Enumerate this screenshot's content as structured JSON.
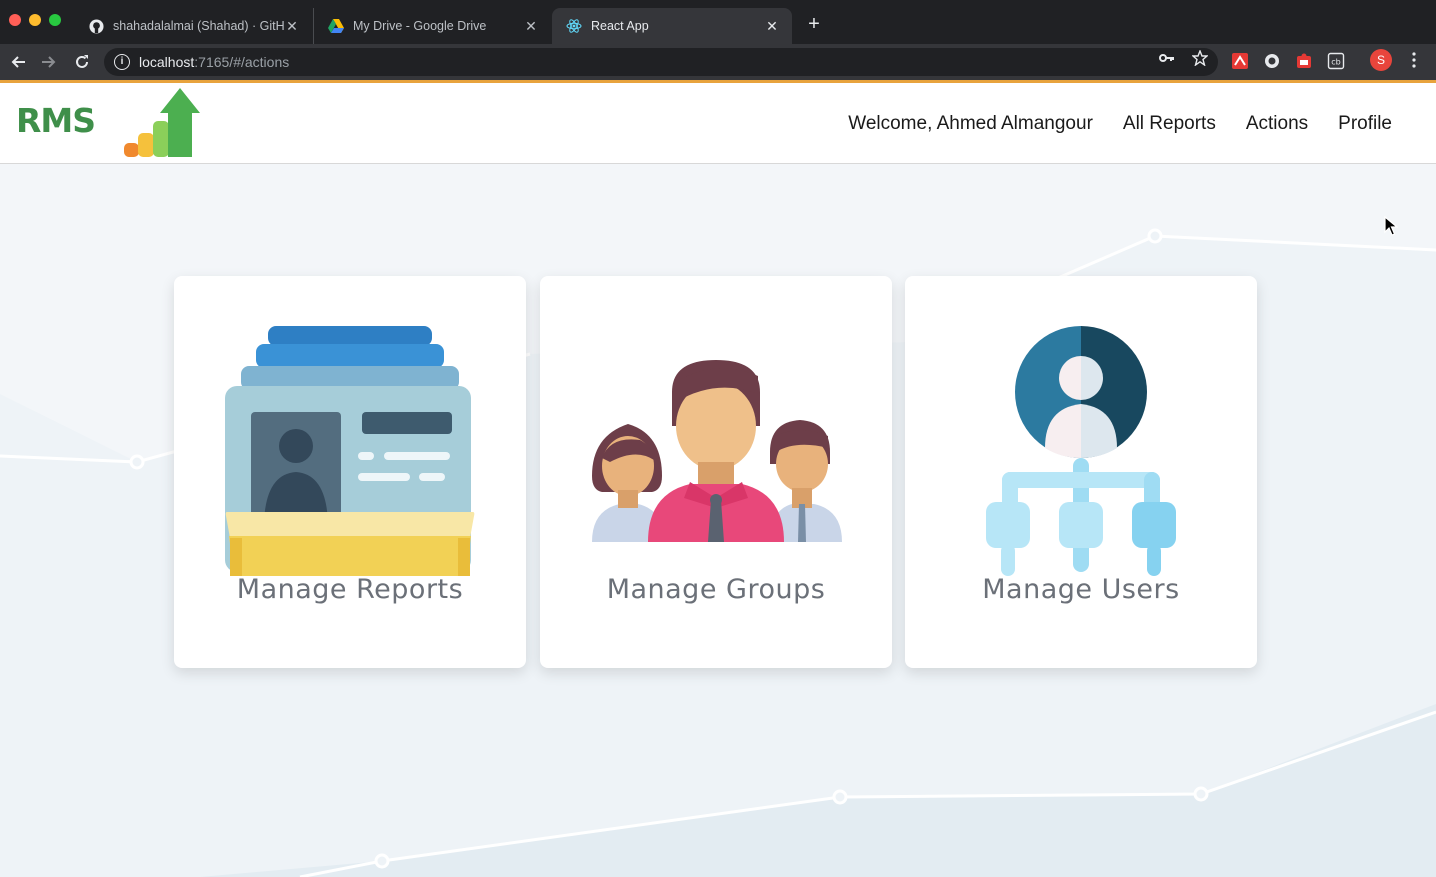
{
  "browser": {
    "tabs": [
      {
        "title": "shahadalalmai (Shahad) · GitHub",
        "icon": "github-icon",
        "active": false
      },
      {
        "title": "My Drive - Google Drive",
        "icon": "google-drive-icon",
        "active": false
      },
      {
        "title": "React App",
        "icon": "react-icon",
        "active": true
      }
    ],
    "address": {
      "host": "localhost",
      "path": ":7165/#/actions"
    },
    "profile_initial": "S"
  },
  "header": {
    "logo_text": "RMS",
    "welcome": "Welcome, Ahmed Almangour",
    "nav": [
      "All Reports",
      "Actions",
      "Profile"
    ]
  },
  "cards": [
    {
      "label": "Manage Reports",
      "icon": "reports-folder-icon"
    },
    {
      "label": "Manage Groups",
      "icon": "group-people-icon"
    },
    {
      "label": "Manage Users",
      "icon": "user-hierarchy-icon"
    }
  ],
  "colors": {
    "brand_green": "#3f8f4a",
    "accent_orange": "#e8a33d",
    "page_bg": "#eef3f7"
  }
}
